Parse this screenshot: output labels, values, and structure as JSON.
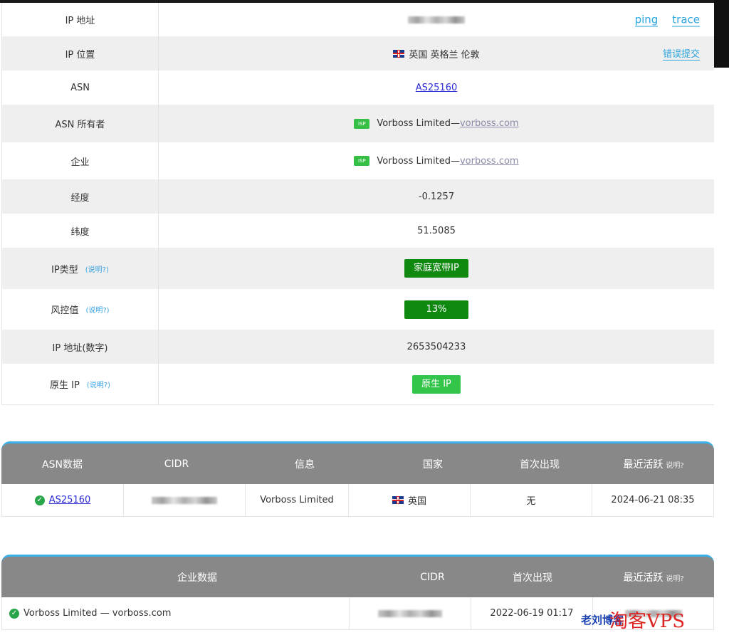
{
  "info": {
    "ip_address_label": "IP 地址",
    "ping_label": "ping",
    "trace_label": "trace",
    "ip_location_label": "IP 位置",
    "ip_location_value": "英国 英格兰 伦敦",
    "report_error_label": "错误提交",
    "asn_label": "ASN",
    "asn_value": "AS25160",
    "asn_owner_label": "ASN 所有者",
    "asn_owner_name": "Vorboss Limited—",
    "asn_owner_domain": "vorboss.com",
    "company_label": "企业",
    "company_name": "Vorboss Limited—",
    "company_domain": "vorboss.com",
    "isp_badge": "ISP",
    "longitude_label": "经度",
    "longitude_value": "-0.1257",
    "latitude_label": "纬度",
    "latitude_value": "51.5085",
    "ip_type_label": "IP类型",
    "ip_type_value": "家庭宽带IP",
    "risk_label": "风控值",
    "risk_value": "13%",
    "ip_numeric_label": "IP 地址(数字)",
    "ip_numeric_value": "2653504233",
    "native_ip_label": "原生 IP",
    "native_ip_value": "原生 IP",
    "help_label": "(说明?)"
  },
  "asn_table": {
    "headers": [
      "ASN数据",
      "CIDR",
      "信息",
      "国家",
      "首次出现",
      "最近活跃"
    ],
    "help_label": "说明?",
    "row": {
      "asn": "AS25160",
      "info": "Vorboss Limited",
      "country": "英国",
      "first_seen": "无",
      "last_active": "2024-06-21 08:35"
    }
  },
  "company_table": {
    "headers": [
      "企业数据",
      "CIDR",
      "首次出现",
      "最近活跃"
    ],
    "help_label": "说明?",
    "row": {
      "company": "Vorboss Limited — vorboss.com",
      "first_seen": "2022-06-19 01:17"
    }
  },
  "watermark": {
    "cn_text": "老刘博客",
    "site_text": "淘客VPS"
  },
  "colors": {
    "accent_blue": "#2ba6de",
    "header_grey": "#888888",
    "ok_green": "#108910",
    "isp_green": "#35c045"
  }
}
